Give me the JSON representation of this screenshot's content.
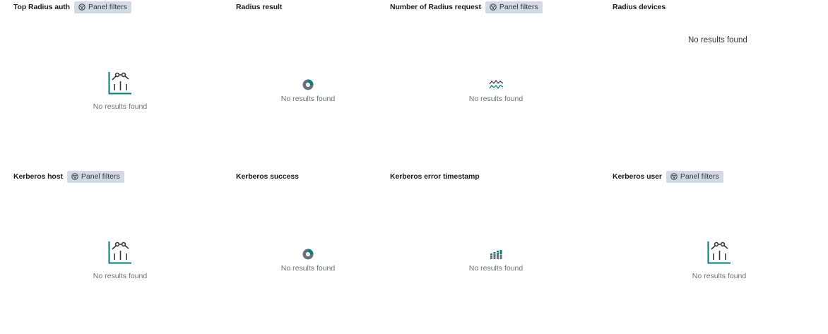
{
  "panels": [
    {
      "title": "Top Radius auth",
      "filter_label": "Panel filters",
      "empty_text": "No results found",
      "icon": "line-chart-icon"
    },
    {
      "title": "Radius result",
      "empty_text": "No results found",
      "icon": "pie-chart-icon"
    },
    {
      "title": "Number of Radius request",
      "filter_label": "Panel filters",
      "empty_text": "No results found",
      "icon": "timeline-icon"
    },
    {
      "title": "Radius devices",
      "empty_text": "No results found"
    },
    {
      "title": "Kerberos host",
      "filter_label": "Panel filters",
      "empty_text": "No results found",
      "icon": "line-chart-icon"
    },
    {
      "title": "Kerberos success",
      "empty_text": "No results found",
      "icon": "pie-chart-icon"
    },
    {
      "title": "Kerberos error timestamp",
      "empty_text": "No results found",
      "icon": "bar-chart-icon"
    },
    {
      "title": "Kerberos user",
      "filter_label": "Panel filters",
      "empty_text": "No results found",
      "icon": "line-chart-icon"
    }
  ],
  "colors": {
    "accent_teal": "#017d73",
    "icon_dark": "#343741",
    "icon_grey": "#69707d",
    "badge_bg": "#d3dae6"
  }
}
